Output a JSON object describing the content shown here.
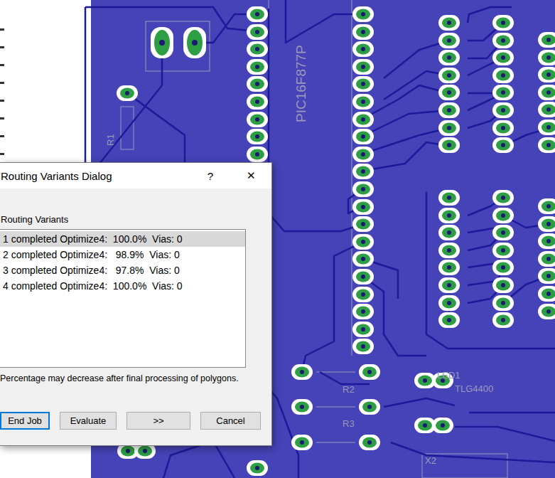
{
  "board": {
    "part_label": "PIC16F877P",
    "labels": [
      "R1",
      "R2",
      "R3",
      "LED1",
      "TLG4400",
      "X2"
    ]
  },
  "dialog": {
    "title": "Routing Variants Dialog",
    "help": "?",
    "close": "✕",
    "group_label": "Routing Variants",
    "variants": [
      {
        "label": "1 completed Optimize4:  100.0%  Vias: 0",
        "selected": true
      },
      {
        "label": "2 completed Optimize4:   98.9%  Vias: 0",
        "selected": false
      },
      {
        "label": "3 completed Optimize4:   97.8%  Vias: 0",
        "selected": false
      },
      {
        "label": "4 completed Optimize4:  100.0%  Vias: 0",
        "selected": false
      }
    ],
    "note": "Percentage may decrease after final processing of polygons.",
    "buttons": [
      {
        "label": "End Job",
        "focused": true
      },
      {
        "label": "Evaluate",
        "focused": false
      },
      {
        "label": ">>",
        "focused": false
      },
      {
        "label": "Cancel",
        "focused": false
      }
    ]
  }
}
